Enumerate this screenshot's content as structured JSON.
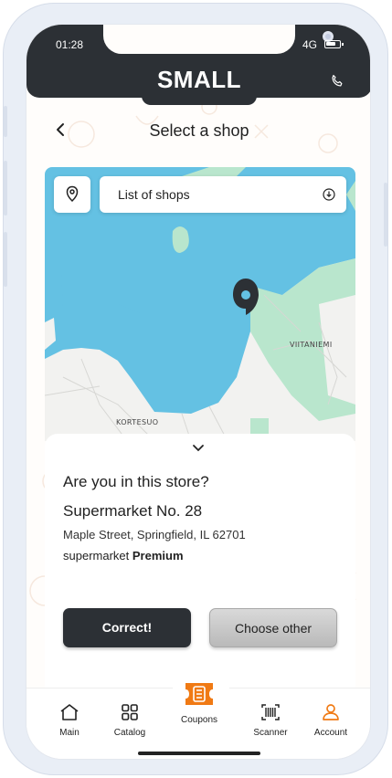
{
  "status": {
    "time": "01:28",
    "network": "4G",
    "battery": 0.75
  },
  "header": {
    "brand": "SMALL"
  },
  "page": {
    "title": "Select a shop"
  },
  "map": {
    "list_label": "List of shops",
    "labels": [
      "VIITANIEMI",
      "KORTESUO"
    ]
  },
  "sheet": {
    "question": "Are you in this store?",
    "shop_name": "Supermarket No. 28",
    "address": "Maple Street, Springfield, IL 62701",
    "type_prefix": "supermarket",
    "type_tier": "Premium"
  },
  "actions": {
    "confirm": "Correct!",
    "other": "Choose other"
  },
  "tabs": [
    {
      "label": "Main",
      "icon": "home-icon"
    },
    {
      "label": "Catalog",
      "icon": "grid-icon"
    },
    {
      "label": "Coupons",
      "icon": "coupon-icon"
    },
    {
      "label": "Scanner",
      "icon": "barcode-icon"
    },
    {
      "label": "Account",
      "icon": "user-icon"
    }
  ],
  "colors": {
    "dark": "#2c3035",
    "accent": "#f07a14",
    "water": "#64c1e3",
    "park": "#b9e6cd"
  }
}
